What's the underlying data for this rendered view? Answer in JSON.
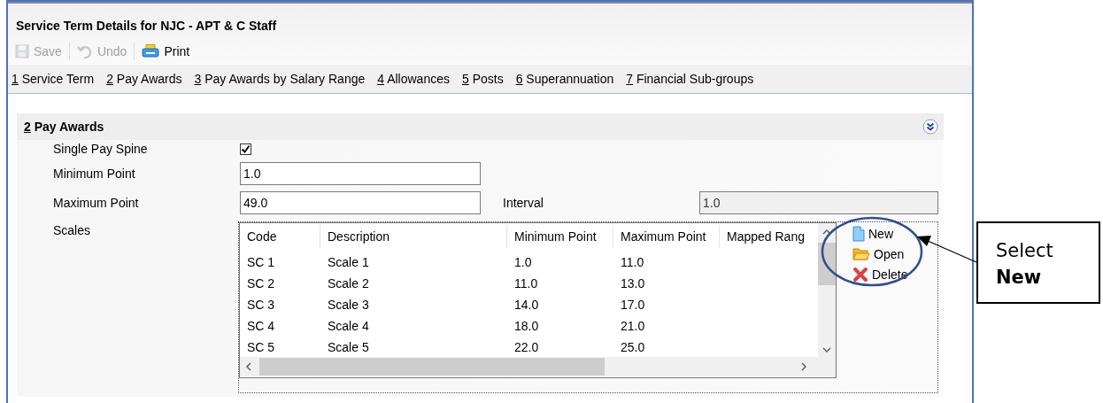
{
  "window": {
    "title": "Service Term Details for NJC - APT & C Staff"
  },
  "toolbar": [
    {
      "kind": "save",
      "label": "Save",
      "disabled": true
    },
    {
      "kind": "undo",
      "label": "Undo",
      "disabled": true
    },
    {
      "kind": "print",
      "label": "Print",
      "disabled": false
    }
  ],
  "tabs": [
    {
      "key": "1",
      "label": "Service Term"
    },
    {
      "key": "2",
      "label": "Pay Awards"
    },
    {
      "key": "3",
      "label": "Pay Awards by Salary Range"
    },
    {
      "key": "4",
      "label": "Allowances"
    },
    {
      "key": "5",
      "label": "Posts"
    },
    {
      "key": "6",
      "label": "Superannuation"
    },
    {
      "key": "7",
      "label": "Financial Sub-groups"
    }
  ],
  "section": {
    "key": "2",
    "title": "Pay Awards"
  },
  "form": {
    "single_pay_spine": {
      "label": "Single Pay Spine",
      "checked": true
    },
    "minimum_point": {
      "label": "Minimum Point",
      "value": "1.0"
    },
    "maximum_point": {
      "label": "Maximum Point",
      "value": "49.0"
    },
    "interval": {
      "label": "Interval",
      "value": "1.0",
      "disabled": true
    },
    "scales": {
      "label": "Scales"
    }
  },
  "table": {
    "columns": [
      "Code",
      "Description",
      "Minimum Point",
      "Maximum Point",
      "Mapped Rang"
    ],
    "rows": [
      [
        "SC 1",
        "Scale 1",
        "1.0",
        "11.0"
      ],
      [
        "SC 2",
        "Scale 2",
        "11.0",
        "13.0"
      ],
      [
        "SC 3",
        "Scale 3",
        "14.0",
        "17.0"
      ],
      [
        "SC 4",
        "Scale 4",
        "18.0",
        "21.0"
      ],
      [
        "SC 5",
        "Scale 5",
        "22.0",
        "25.0"
      ]
    ]
  },
  "side_buttons": [
    {
      "kind": "new",
      "label": "New"
    },
    {
      "kind": "open",
      "label": "Open"
    },
    {
      "kind": "delete",
      "label": "Delete"
    }
  ],
  "callout": {
    "text": "Select **New**"
  }
}
